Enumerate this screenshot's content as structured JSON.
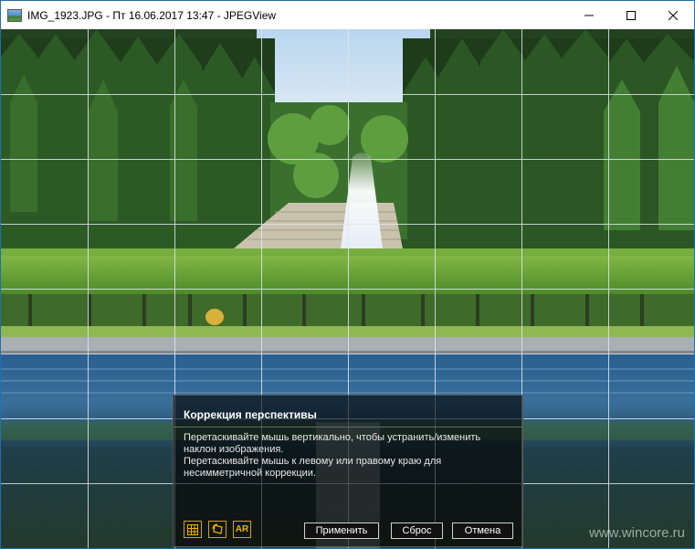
{
  "window": {
    "title": "IMG_1923.JPG - Пт 16.06.2017 13:47 - JPEGView",
    "icon": "jpegview-app-icon",
    "controls": [
      "minimize-icon",
      "maximize-icon",
      "close-icon"
    ]
  },
  "viewer": {
    "grid": "3x? perspective grid overlay, white lines"
  },
  "panel": {
    "title": "Коррекция перспективы",
    "lines": [
      "Перетаскивайте мышь вертикально, чтобы устранить/изменить",
      "наклон изображения.",
      "Перетаскивайте мышь к левому или правому краю для",
      "несимметричной коррекции."
    ],
    "tools": {
      "grid_icon": "grid-icon",
      "rotate_icon": "rotate-icon",
      "ar_label": "AR"
    },
    "buttons": {
      "apply": "Применить",
      "reset": "Сброс",
      "cancel": "Отмена"
    },
    "accent_color": "#f0b400"
  },
  "watermark": "www.wincore.ru"
}
